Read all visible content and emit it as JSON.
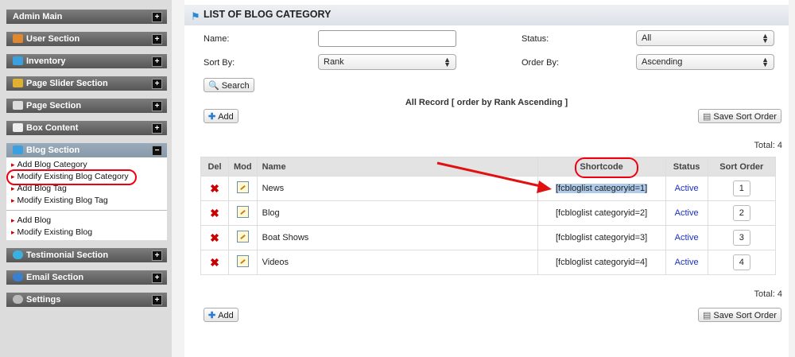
{
  "sidebar": {
    "sections": [
      {
        "label": "Admin Main",
        "toggle": "+"
      },
      {
        "label": "User Section",
        "toggle": "+"
      },
      {
        "label": "Inventory",
        "toggle": "+"
      },
      {
        "label": "Page Slider Section",
        "toggle": "+"
      },
      {
        "label": "Page Section",
        "toggle": "+"
      },
      {
        "label": "Box Content",
        "toggle": "+"
      },
      {
        "label": "Blog Section",
        "toggle": "−"
      },
      {
        "label": "Testimonial Section",
        "toggle": "+"
      },
      {
        "label": "Email Section",
        "toggle": "+"
      },
      {
        "label": "Settings",
        "toggle": "+"
      }
    ],
    "blog_links": [
      "Add Blog Category",
      "Modify Existing Blog Category",
      "Add Blog Tag",
      "Modify Existing Blog Tag",
      "Add Blog",
      "Modify Existing Blog"
    ]
  },
  "page": {
    "title": "LIST OF BLOG CATEGORY"
  },
  "filters": {
    "name_label": "Name:",
    "name_value": "",
    "status_label": "Status:",
    "status_value": "All",
    "sort_by_label": "Sort By:",
    "sort_by_value": "Rank",
    "order_by_label": "Order By:",
    "order_by_value": "Ascending",
    "search_label": "Search"
  },
  "toolbar": {
    "add_label": "Add",
    "record_info": "All Record [ order by Rank Ascending ]",
    "save_sort_label": "Save Sort Order",
    "total_label": "Total: 4"
  },
  "table": {
    "headers": [
      "Del",
      "Mod",
      "Name",
      "Shortcode",
      "Status",
      "Sort Order"
    ],
    "rows": [
      {
        "name": "News",
        "shortcode": "[fcbloglist categoryid=1]",
        "status": "Active",
        "order": "1"
      },
      {
        "name": "Blog",
        "shortcode": "[fcbloglist categoryid=2]",
        "status": "Active",
        "order": "2"
      },
      {
        "name": "Boat Shows",
        "shortcode": "[fcbloglist categoryid=3]",
        "status": "Active",
        "order": "3"
      },
      {
        "name": "Videos",
        "shortcode": "[fcbloglist categoryid=4]",
        "status": "Active",
        "order": "4"
      }
    ]
  },
  "colors": {
    "accent_red": "#e01111",
    "link_blue": "#1a2fbf",
    "highlight": "#aecbeb"
  }
}
